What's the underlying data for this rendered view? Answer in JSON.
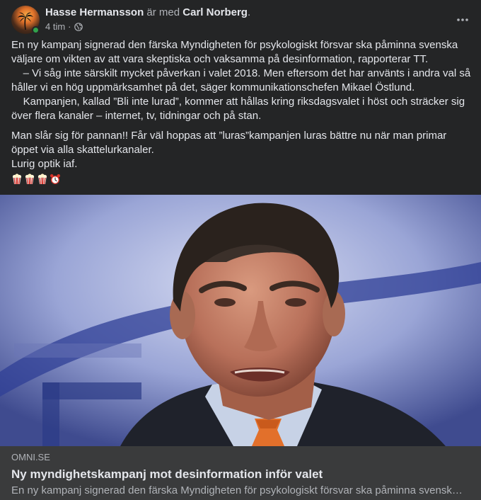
{
  "post": {
    "author": "Hasse Hermansson",
    "with_text": "är med",
    "tagged": "Carl Norberg",
    "tagged_suffix": ".",
    "time": "4 tim",
    "separator": "·",
    "privacy_icon": "globe-icon",
    "more_icon": "more-horizontal-icon",
    "text": {
      "line1": "En ny kampanj signerad den färska Myndigheten för psykologiskt försvar ska påminna svenska",
      "line2": "väljare om vikten av att vara skeptiska och vaksamma på desinformation, rapporterar TT.",
      "line3": "    – Vi såg inte särskilt mycket påverkan i valet 2018. Men eftersom det har använts i andra val så",
      "line4": "håller vi en hög uppmärksamhet på det, säger kommunikationschefen Mikael Östlund.",
      "line5": "    Kampanjen, kallad ”Bli inte lurad”, kommer att hållas kring riksdagsvalet i höst och sträcker sig",
      "line6": "över flera kanaler – internet, tv, tidningar och på stan.",
      "line7": "Man slår sig för pannan!! Får väl hoppas att ”luras”kampanjen luras bättre nu när man primar",
      "line8": "öppet via alla skattelurkanaler.",
      "line9": "Lurig optik iaf."
    },
    "emojis": [
      "popcorn",
      "popcorn",
      "popcorn",
      "alarm-clock"
    ]
  },
  "link": {
    "domain": "OMNI.SE",
    "title": "Ny myndighetskampanj mot desinformation inför valet",
    "description": "En ny kampanj signerad den färska Myndigheten för psykologiskt försvar ska påminna svensk…"
  },
  "colors": {
    "card_bg": "#242526",
    "link_footer_bg": "#3a3b3c",
    "primary_text": "#e4e6eb",
    "secondary_text": "#b0b3b8",
    "online": "#31a24c"
  }
}
